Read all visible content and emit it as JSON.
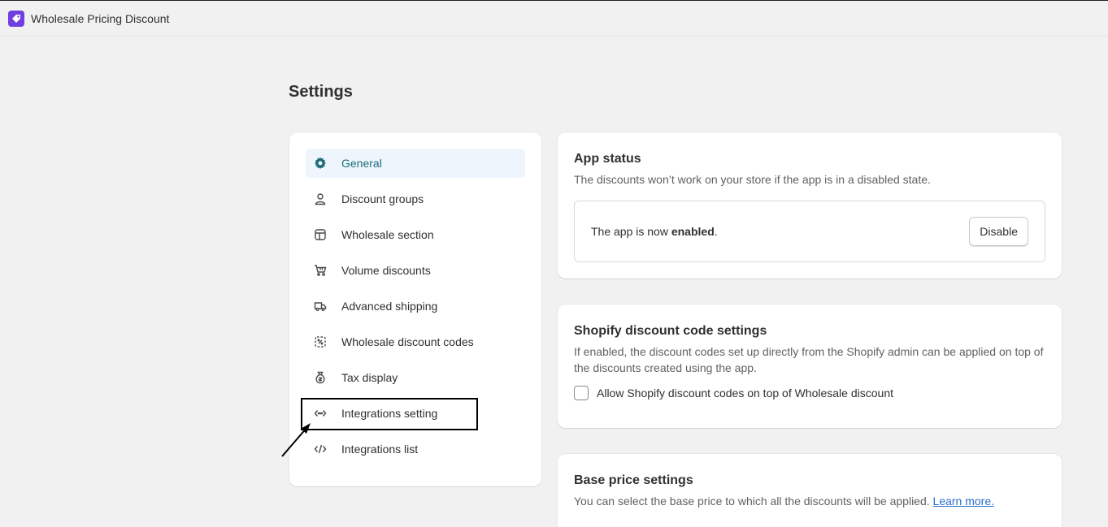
{
  "app": {
    "title": "Wholesale Pricing Discount"
  },
  "page": {
    "title": "Settings"
  },
  "nav": {
    "items": [
      {
        "label": "General",
        "icon": "gear-icon",
        "active": true
      },
      {
        "label": "Discount groups",
        "icon": "person-icon"
      },
      {
        "label": "Wholesale section",
        "icon": "layout-icon"
      },
      {
        "label": "Volume discounts",
        "icon": "cart-icon"
      },
      {
        "label": "Advanced shipping",
        "icon": "truck-icon"
      },
      {
        "label": "Wholesale discount codes",
        "icon": "discount-code-icon"
      },
      {
        "label": "Tax display",
        "icon": "money-bag-icon"
      },
      {
        "label": "Integrations setting",
        "icon": "code-dots-icon"
      },
      {
        "label": "Integrations list",
        "icon": "code-icon"
      }
    ]
  },
  "app_status": {
    "title": "App status",
    "description": "The discounts won’t work on your store if the app is in a disabled state.",
    "status_prefix": "The app is now ",
    "status_value": "enabled",
    "status_suffix": ".",
    "button_label": "Disable"
  },
  "discount_code_settings": {
    "title": "Shopify discount code settings",
    "description": "If enabled, the discount codes set up directly from the Shopify admin can be applied on top of the discounts created using the app.",
    "checkbox_label": "Allow Shopify discount codes on top of Wholesale discount",
    "checkbox_checked": false
  },
  "base_price_settings": {
    "title": "Base price settings",
    "description": "You can select the base price to which all the discounts will be applied. ",
    "link_label": "Learn more."
  },
  "colors": {
    "accent": "#1c6f7b",
    "active_bg": "#eef5fd",
    "logo": "#6f3fe0",
    "link": "#2c6ecb"
  }
}
